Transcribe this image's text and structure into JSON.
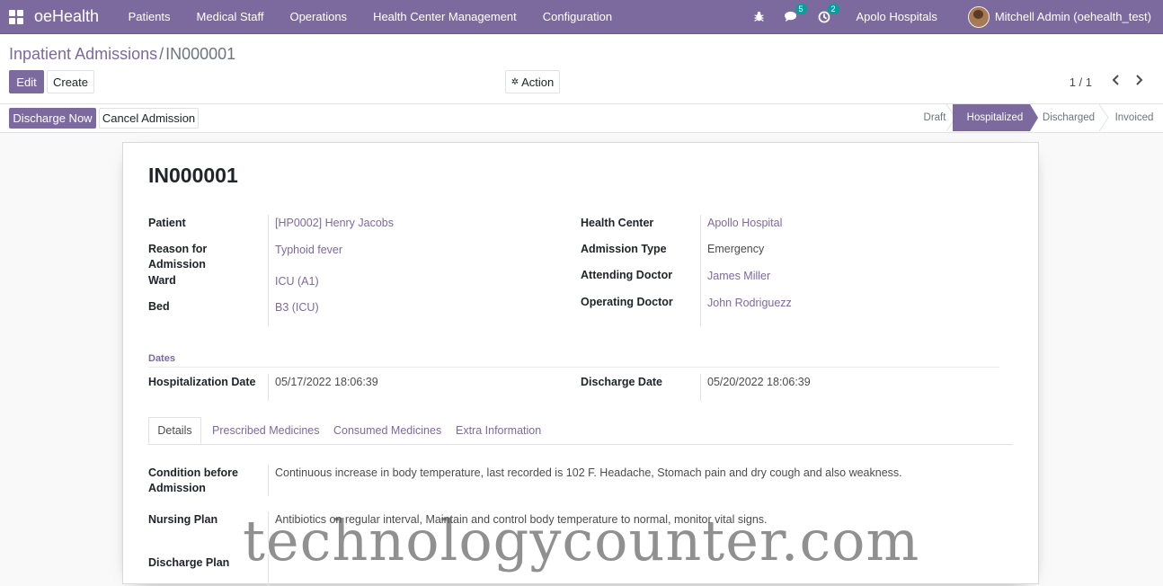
{
  "navbar": {
    "brand": "oeHealth",
    "menu": [
      "Patients",
      "Medical Staff",
      "Operations",
      "Health Center Management",
      "Configuration"
    ],
    "icons": {
      "debug": "bug-icon",
      "messages": "chat-icon",
      "activities": "clock-icon"
    },
    "message_count": "5",
    "activity_count": "2",
    "company": "Apolo Hospitals",
    "user": "Mitchell Admin (oehealth_test)"
  },
  "breadcrumb": {
    "parent": "Inpatient Admissions",
    "separator": "/",
    "current": "IN000001"
  },
  "toolbar": {
    "edit": "Edit",
    "create": "Create",
    "action": "Action",
    "pager": "1 / 1"
  },
  "status_actions": {
    "discharge": "Discharge Now",
    "cancel": "Cancel Admission"
  },
  "stages": [
    "Draft",
    "Hospitalized",
    "Discharged",
    "Invoiced"
  ],
  "active_stage": "Hospitalized",
  "record": {
    "title": "IN000001",
    "patient_label": "Patient",
    "patient": "[HP0002] Henry Jacobs",
    "reason_label_1": "Reason for",
    "reason_label_2": "Admission",
    "reason": "Typhoid fever",
    "ward_label": "Ward",
    "ward": "ICU (A1)",
    "bed_label": "Bed",
    "bed": "B3 (ICU)",
    "health_center_label": "Health Center",
    "health_center": "Apollo Hospital",
    "admission_type_label": "Admission Type",
    "admission_type": "Emergency",
    "attending_label": "Attending Doctor",
    "attending": "James Miller",
    "operating_label": "Operating Doctor",
    "operating": "John Rodriguezz",
    "dates_title": "Dates",
    "hosp_date_label": "Hospitalization Date",
    "hosp_date": "05/17/2022 18:06:39",
    "discharge_date_label": "Discharge Date",
    "discharge_date": "05/20/2022 18:06:39"
  },
  "tabs": [
    "Details",
    "Prescribed Medicines",
    "Consumed Medicines",
    "Extra Information"
  ],
  "details": {
    "condition_label_1": "Condition before",
    "condition_label_2": "Admission",
    "condition": "Continuous increase in body temperature, last recorded is 102 F. Headache, Stomach pain and dry cough and also weakness.",
    "nursing_label": "Nursing Plan",
    "nursing": "Antibiotics on regular interval, Maintain and control body temperature to normal, monitor vital signs.",
    "discharge_plan_label": "Discharge Plan"
  },
  "watermark": "technologycounter.com"
}
